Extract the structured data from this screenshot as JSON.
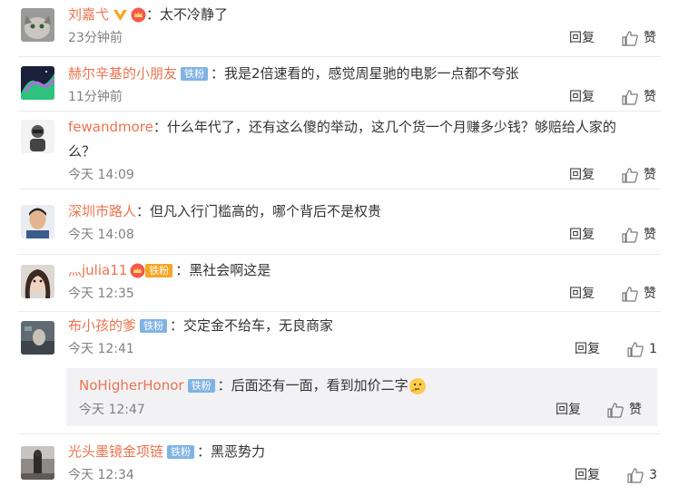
{
  "comments": [
    {
      "user": "刘嘉弋",
      "badge": "",
      "text": "：太不冷静了",
      "time": "23分钟前",
      "reply": "回复",
      "like": "赞"
    },
    {
      "user": "赫尔辛基的小朋友",
      "badge": "铁粉",
      "text": "：我是2倍速看的，感觉周星驰的电影一点都不夸张",
      "time": "11分钟前",
      "reply": "回复",
      "like": "赞"
    },
    {
      "user": "fewandmore",
      "badge": "",
      "text": "：什么年代了，还有这么傻的举动，这几个货一个月赚多少钱？够赔给人家的",
      "text2": "么？",
      "time": "今天 14:09",
      "reply": "回复",
      "like": "赞"
    },
    {
      "user": "深圳市路人",
      "badge": "",
      "text": "：但凡入行门槛高的，哪个背后不是权贵",
      "time": "今天 14:08",
      "reply": "回复",
      "like": "赞"
    },
    {
      "user": "灬julia11",
      "badge": "铁粉",
      "text": "：黑社会啊这是",
      "time": "今天 12:35",
      "reply": "回复",
      "like": "赞"
    },
    {
      "user": "布小孩的爹",
      "badge": "铁粉",
      "text": "：交定金不给车，无良商家",
      "time": "今天 12:41",
      "reply": "回复",
      "like": "1"
    },
    {
      "user": "光头墨镜金项链",
      "badge": "铁粉",
      "text": "：黑恶势力",
      "time": "今天 12:34",
      "reply": "回复",
      "like": "3"
    }
  ],
  "subreply": {
    "user": "NoHigherHonor",
    "badge": "铁粉",
    "text": "：后面还有一面，看到加价二字",
    "time": "今天 12:47",
    "reply": "回复",
    "like": "赞"
  }
}
